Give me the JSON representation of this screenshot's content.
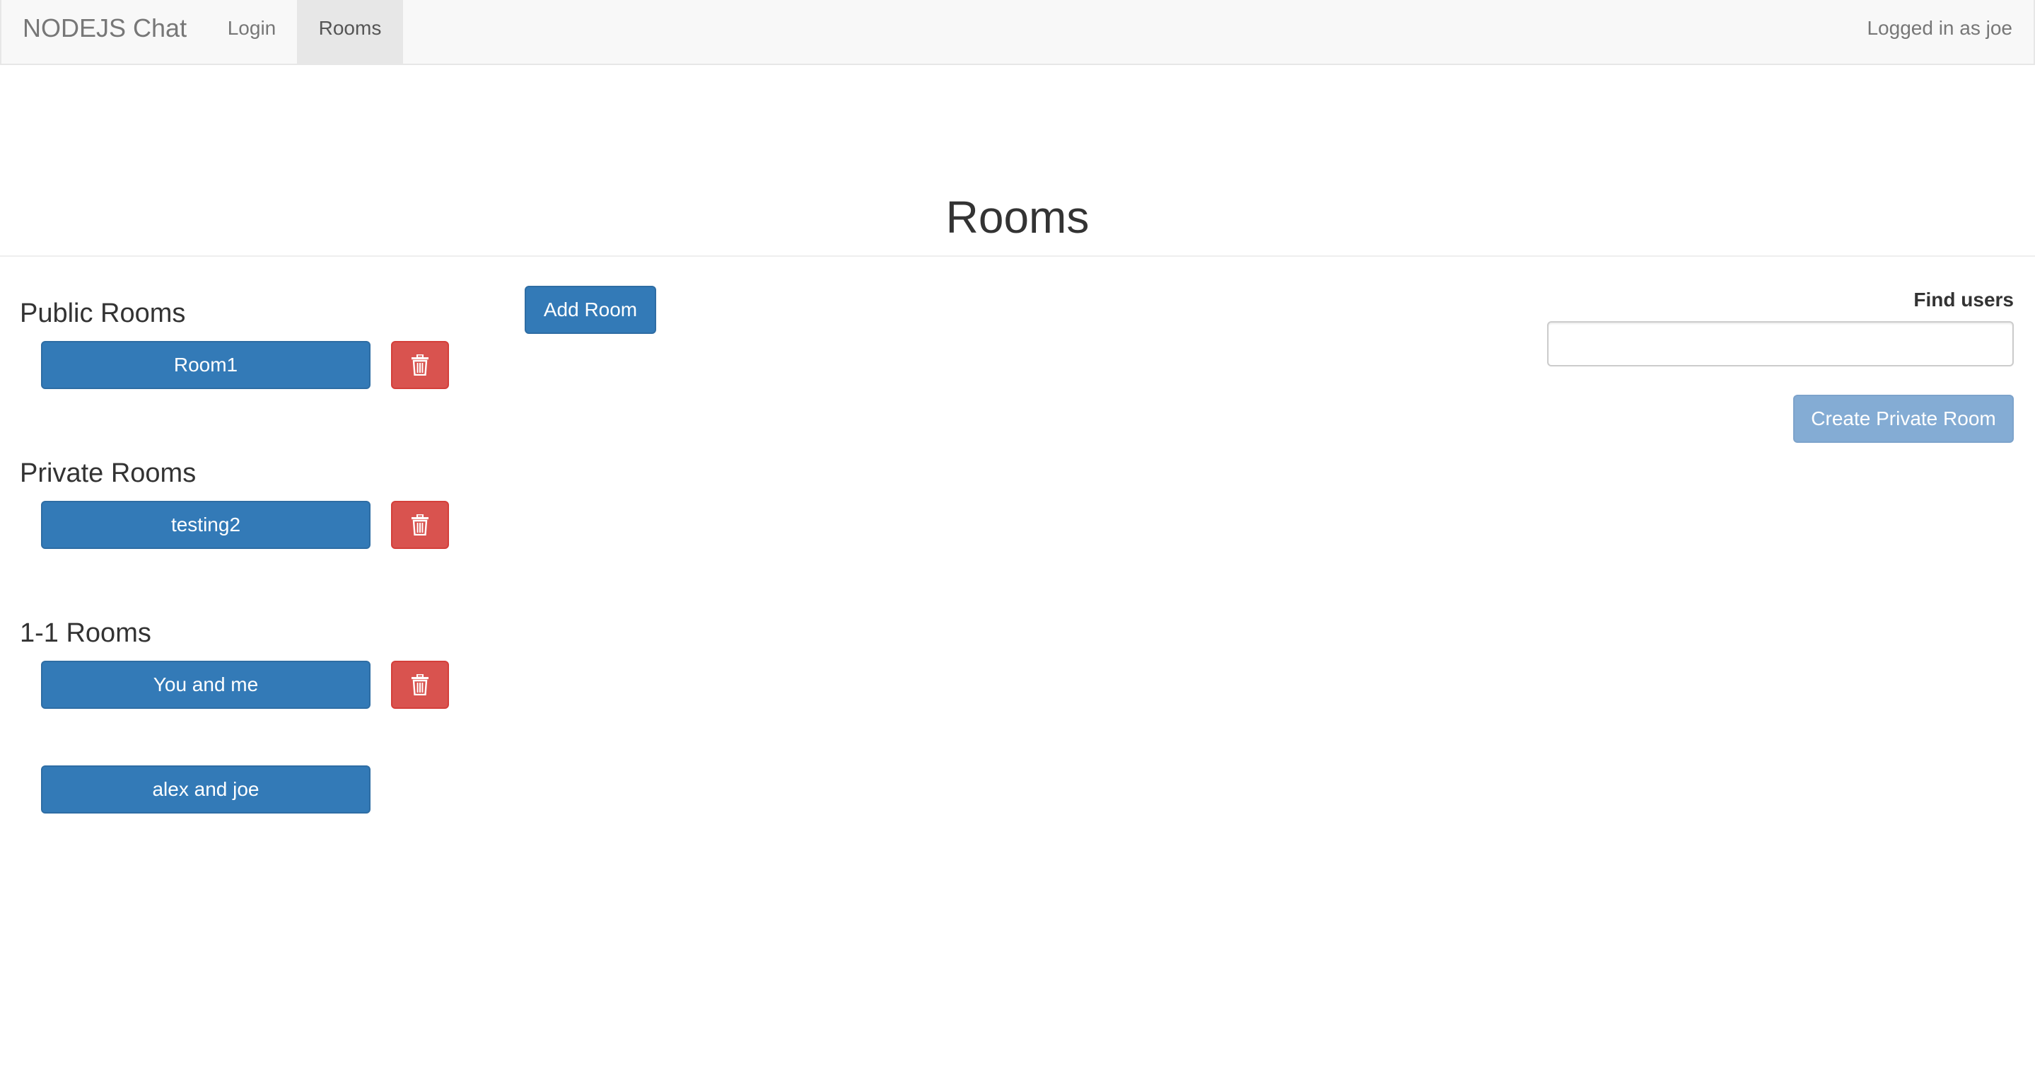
{
  "navbar": {
    "brand": "NODEJS Chat",
    "items": [
      {
        "label": "Login",
        "active": false
      },
      {
        "label": "Rooms",
        "active": true
      }
    ],
    "user_status": "Logged in as joe"
  },
  "page": {
    "title": "Rooms"
  },
  "sections": {
    "public": {
      "heading": "Public Rooms",
      "rooms": [
        {
          "label": "Room1",
          "deletable": true
        }
      ]
    },
    "private": {
      "heading": "Private Rooms",
      "rooms": [
        {
          "label": "testing2",
          "deletable": true
        }
      ]
    },
    "one_on_one": {
      "heading": "1-1 Rooms",
      "rooms": [
        {
          "label": "You and me",
          "deletable": true
        },
        {
          "label": "alex and joe",
          "deletable": false
        }
      ]
    }
  },
  "actions": {
    "add_room_label": "Add Room",
    "create_private_label": "Create Private Room",
    "create_private_disabled": true
  },
  "find_users": {
    "label": "Find users",
    "value": "",
    "placeholder": ""
  },
  "icons": {
    "delete": "trash-icon"
  },
  "colors": {
    "primary": "#337ab7",
    "danger": "#d9534f",
    "primary_disabled": "#84acd4",
    "navbar_bg": "#f8f8f8"
  }
}
